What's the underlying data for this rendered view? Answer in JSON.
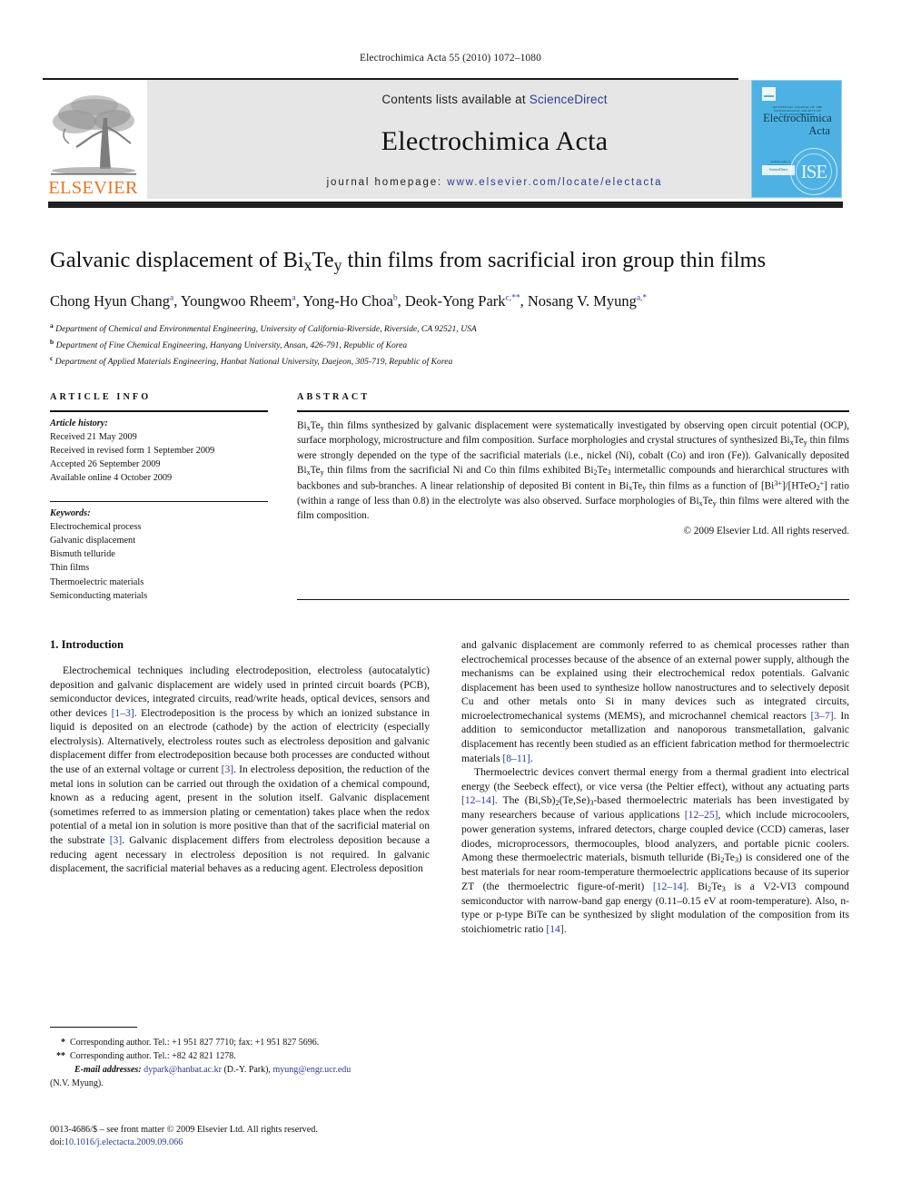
{
  "running_head": "Electrochimica Acta 55 (2010) 1072–1080",
  "masthead": {
    "contents_prefix": "Contents lists available at ",
    "sciencedirect": "ScienceDirect",
    "journal_title": "Electrochimica Acta",
    "homepage_prefix": "journal homepage: ",
    "homepage_url": "www.elsevier.com/locate/electacta",
    "publisher_logo_text": "ELSEVIER",
    "publisher_logo_color": "#E87722",
    "link_color": "#2c3c8f"
  },
  "cover": {
    "society_line": "AN OFFICIAL JOURNAL OF THE INTERNATIONAL SOCIETY OF ELECTROCHEMISTRY",
    "title_line1": "Electrochimica",
    "title_line2": "Acta",
    "sciencedirect_badge": "ScienceDirect",
    "sciencedirect_caption": "Available online at www.sciencedirect.com",
    "ise_monogram": "ISE",
    "background_color": "#4db2e3"
  },
  "article": {
    "title_parts": {
      "p1": "Galvanic displacement of Bi",
      "sub1": "x",
      "p2": "Te",
      "sub2": "y",
      "p3": " thin films from sacrificial iron group thin films"
    },
    "authors": [
      {
        "name": "Chong Hyun Chang",
        "marks": "a"
      },
      {
        "name": "Youngwoo Rheem",
        "marks": "a"
      },
      {
        "name": "Yong-Ho Choa",
        "marks": "b"
      },
      {
        "name": "Deok-Yong Park",
        "marks": "c,**"
      },
      {
        "name": "Nosang V. Myung",
        "marks": "a,*"
      }
    ],
    "affiliations": [
      {
        "mark": "a",
        "text": "Department of Chemical and Environmental Engineering, University of California-Riverside, Riverside, CA 92521, USA"
      },
      {
        "mark": "b",
        "text": "Department of Fine Chemical Engineering, Hanyang University, Ansan, 426-791, Republic of Korea"
      },
      {
        "mark": "c",
        "text": "Department of Applied Materials Engineering, Hanbat National University, Daejeon, 305-719, Republic of Korea"
      }
    ]
  },
  "article_info": {
    "label": "ARTICLE INFO",
    "history_heading": "Article history:",
    "history": [
      "Received 21 May 2009",
      "Received in revised form 1 September 2009",
      "Accepted 26 September 2009",
      "Available online 4 October 2009"
    ],
    "keywords_heading": "Keywords:",
    "keywords": [
      "Electrochemical process",
      "Galvanic displacement",
      "Bismuth telluride",
      "Thin films",
      "Thermoelectric materials",
      "Semiconducting materials"
    ]
  },
  "abstract": {
    "label": "ABSTRACT",
    "text": "BixTey thin films synthesized by galvanic displacement were systematically investigated by observing open circuit potential (OCP), surface morphology, microstructure and film composition. Surface morphologies and crystal structures of synthesized BixTey thin films were strongly depended on the type of the sacrificial materials (i.e., nickel (Ni), cobalt (Co) and iron (Fe)). Galvanically deposited BixTey thin films from the sacrificial Ni and Co thin films exhibited Bi2Te3 intermetallic compounds and hierarchical structures with backbones and sub-branches. A linear relationship of deposited Bi content in BixTey thin films as a function of [Bi3+]/[HTeO2+] ratio (within a range of less than 0.8) in the electrolyte was also observed. Surface morphologies of BixTey thin films were altered with the film composition.",
    "copyright": "© 2009 Elsevier Ltd. All rights reserved."
  },
  "body": {
    "section_heading": "1. Introduction",
    "left_paragraph_1": "Electrochemical techniques including electrodeposition, electroless (autocatalytic) deposition and galvanic displacement are widely used in printed circuit boards (PCB), semiconductor devices, integrated circuits, read/write heads, optical devices, sensors and other devices [1–3]. Electrodeposition is the process by which an ionized substance in liquid is deposited on an electrode (cathode) by the action of electricity (especially electrolysis). Alternatively, electroless routes such as electroless deposition and galvanic displacement differ from electrodeposition because both processes are conducted without the use of an external voltage or current [3]. In electroless deposition, the reduction of the metal ions in solution can be carried out through the oxidation of a chemical compound, known as a reducing agent, present in the solution itself. Galvanic displacement (sometimes referred to as immersion plating or cementation) takes place when the redox potential of a metal ion in solution is more positive than that of the sacrificial material on the substrate [3]. Galvanic displacement differs from electroless deposition because a reducing agent necessary in electroless deposition is not required. In galvanic displacement, the sacrificial material behaves as a reducing agent. Electroless deposition",
    "right_paragraph_1": "and galvanic displacement are commonly referred to as chemical processes rather than electrochemical processes because of the absence of an external power supply, although the mechanisms can be explained using their electrochemical redox potentials. Galvanic displacement has been used to synthesize hollow nanostructures and to selectively deposit Cu and other metals onto Si in many devices such as integrated circuits, microelectromechanical systems (MEMS), and microchannel chemical reactors [3–7]. In addition to semiconductor metallization and nanoporous transmetallation, galvanic displacement has recently been studied as an efficient fabrication method for thermoelectric materials [8–11].",
    "right_paragraph_2": "Thermoelectric devices convert thermal energy from a thermal gradient into electrical energy (the Seebeck effect), or vice versa (the Peltier effect), without any actuating parts [12–14]. The (Bi,Sb)2(Te,Se)3-based thermoelectric materials has been investigated by many researchers because of various applications [12–25], which include microcoolers, power generation systems, infrared detectors, charge coupled device (CCD) cameras, laser diodes, microprocessors, thermocouples, blood analyzers, and portable picnic coolers. Among these thermoelectric materials, bismuth telluride (Bi2Te3) is considered one of the best materials for near room-temperature thermoelectric applications because of its superior ZT (the thermoelectric figure-of-merit) [12–14]. Bi2Te3 is a V2-VI3 compound semiconductor with narrow-band gap energy (0.11–0.15 eV at room-temperature). Also, n-type or p-type BiTe can be synthesized by slight modulation of the composition from its stoichiometric ratio [14]."
  },
  "footnotes": {
    "note1_mark": "*",
    "note1_text": "Corresponding author. Tel.: +1 951 827 7710; fax: +1 951 827 5696.",
    "note2_mark": "**",
    "note2_text": "Corresponding author. Tel.: +82 42 821 1278.",
    "email_label": "E-mail addresses:",
    "email1": "dypark@hanbat.ac.kr",
    "email1_owner": "(D.-Y. Park),",
    "email2": "myung@engr.ucr.edu",
    "email2_owner": "(N.V. Myung)."
  },
  "imprint": {
    "issn_line": "0013-4686/$ – see front matter © 2009 Elsevier Ltd. All rights reserved.",
    "doi_prefix": "doi:",
    "doi": "10.1016/j.electacta.2009.09.066"
  }
}
